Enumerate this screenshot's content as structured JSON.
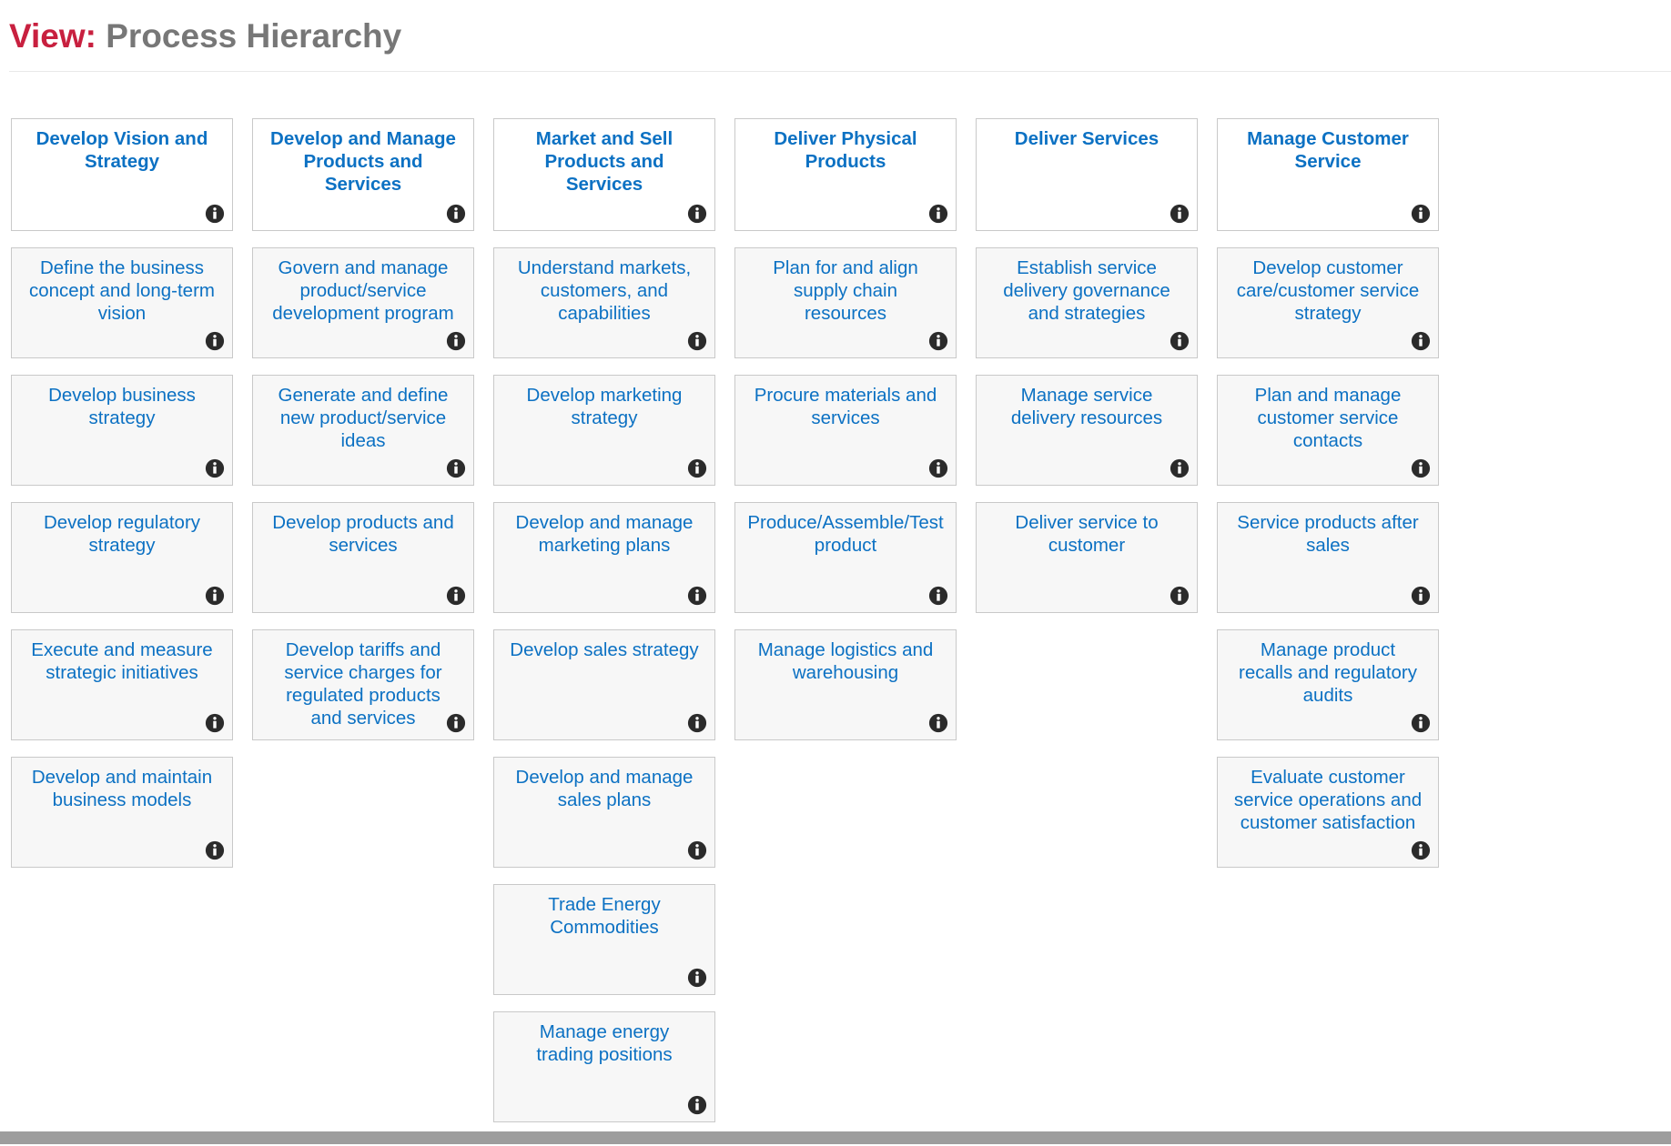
{
  "header": {
    "view_label": "View:",
    "view_value": "Process Hierarchy",
    "accent_color": "#c8203f",
    "value_color": "#777777"
  },
  "icons": {
    "info": "info-icon"
  },
  "colors": {
    "link_blue": "#0c71c3",
    "card_bg": "#f7f7f7",
    "header_card_bg": "#ffffff",
    "card_border": "#c9c9c9",
    "scrollbar": "#9d9d9d"
  },
  "columns": [
    {
      "id": "develop-vision-and-strategy",
      "header": {
        "lines": [
          "Develop Vision and",
          "Strategy"
        ]
      },
      "cards": [
        {
          "lines": [
            "Define the business",
            "concept and long-term",
            "vision"
          ]
        },
        {
          "lines": [
            "Develop business",
            "strategy"
          ]
        },
        {
          "lines": [
            "Develop regulatory",
            "strategy"
          ]
        },
        {
          "lines": [
            "Execute and measure",
            "strategic initiatives"
          ]
        },
        {
          "lines": [
            "Develop and maintain",
            "business models"
          ]
        }
      ]
    },
    {
      "id": "develop-and-manage-products-and-services",
      "header": {
        "lines": [
          "Develop and Manage",
          "Products and",
          "Services"
        ]
      },
      "cards": [
        {
          "lines": [
            "Govern and manage",
            "product/service",
            "development program"
          ]
        },
        {
          "lines": [
            "Generate and define",
            "new product/service",
            "ideas"
          ]
        },
        {
          "lines": [
            "Develop products and",
            "services"
          ]
        },
        {
          "lines": [
            "Develop tariffs and",
            "service charges for",
            "regulated products",
            "and services"
          ]
        }
      ]
    },
    {
      "id": "market-and-sell-products-and-services",
      "header": {
        "lines": [
          "Market and Sell",
          "Products and",
          "Services"
        ]
      },
      "cards": [
        {
          "lines": [
            "Understand markets,",
            "customers, and",
            "capabilities"
          ]
        },
        {
          "lines": [
            "Develop marketing",
            "strategy"
          ]
        },
        {
          "lines": [
            "Develop and manage",
            "marketing plans"
          ]
        },
        {
          "lines": [
            "Develop sales strategy"
          ]
        },
        {
          "lines": [
            "Develop and manage",
            "sales plans"
          ]
        },
        {
          "lines": [
            "Trade Energy",
            "Commodities"
          ]
        },
        {
          "lines": [
            "Manage energy",
            "trading positions"
          ]
        }
      ]
    },
    {
      "id": "deliver-physical-products",
      "header": {
        "lines": [
          "Deliver Physical",
          "Products"
        ]
      },
      "cards": [
        {
          "lines": [
            "Plan for and align",
            "supply chain",
            "resources"
          ]
        },
        {
          "lines": [
            "Procure materials and",
            "services"
          ]
        },
        {
          "lines": [
            "Produce/Assemble/Test",
            "product"
          ]
        },
        {
          "lines": [
            "Manage logistics and",
            "warehousing"
          ]
        }
      ]
    },
    {
      "id": "deliver-services",
      "header": {
        "lines": [
          "Deliver Services"
        ]
      },
      "cards": [
        {
          "lines": [
            "Establish service",
            "delivery governance",
            "and strategies"
          ]
        },
        {
          "lines": [
            "Manage service",
            "delivery resources"
          ]
        },
        {
          "lines": [
            "Deliver service to",
            "customer"
          ]
        }
      ]
    },
    {
      "id": "manage-customer-service",
      "header": {
        "lines": [
          "Manage Customer",
          "Service"
        ]
      },
      "cards": [
        {
          "lines": [
            "Develop customer",
            "care/customer service",
            "strategy"
          ]
        },
        {
          "lines": [
            "Plan and manage",
            "customer service",
            "contacts"
          ]
        },
        {
          "lines": [
            "Service products after",
            "sales"
          ]
        },
        {
          "lines": [
            "Manage product",
            "recalls and regulatory",
            "audits"
          ]
        },
        {
          "lines": [
            "Evaluate customer",
            "service operations and",
            "customer satisfaction"
          ]
        }
      ]
    }
  ]
}
